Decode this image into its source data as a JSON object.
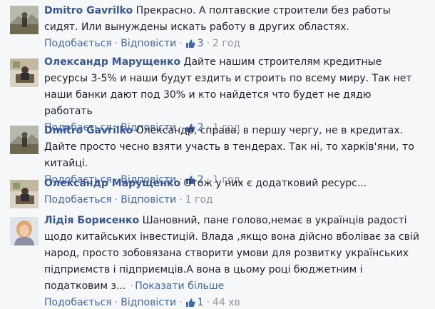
{
  "colors": {
    "author": "#365899",
    "link": "#4267b2",
    "meta": "#90949c",
    "text": "#1d2129",
    "background": "#f6f7f9"
  },
  "comments": [
    {
      "author": "Dmitro Gavrilko",
      "text": "Прекрасно. А полтавские строители без работы сидят. Или вынуждены искать работу в других областях.",
      "like_label": "Подобається",
      "reply_label": "Відповісти",
      "like_count": "3",
      "time": "2 год",
      "avatar_icon": "outdoor-photo-avatar"
    },
    {
      "author": "Олександр Марущенко",
      "text": "Дайте нашим строителям кредитные ресурсы 3-5% и наши будут ездить и строить по всему миру. Так нет наши банки дают под 30% и кто найдется что будет не дядю работать",
      "like_label": "Подобається",
      "reply_label": "Відповісти",
      "like_count": "2",
      "time": "1 год",
      "avatar_icon": "office-photo-avatar"
    },
    {
      "author": "Dmitro Gavrilko",
      "text": "Олександр, справа, в першу чергу, не в кредитах. Дайте просто чесно взяти участь в тендерах. Так ні, то харків'яни, то китайці.",
      "like_label": "Подобається",
      "reply_label": "Відповісти",
      "like_count": "2",
      "time": "1 год",
      "avatar_icon": "outdoor-photo-avatar"
    },
    {
      "author": "Олександр Марущенко",
      "text": "Отож у них є додатковий ресурс...",
      "like_label": "Подобається",
      "reply_label": "Відповісти",
      "like_count": "",
      "time": "1 год",
      "avatar_icon": "office-photo-avatar"
    },
    {
      "author": "Лідія Борисенко",
      "text": "Шановний, пане голово,немає в українців радості щодо китайських інвестицій. Влада ,якщо вона дійсно вболіває за свій народ, просто зобовязана створити умови для розвитку українських підприємств і підприємців.А вона в цьому році бюджетним і податковим з...",
      "see_more": "Показати більше",
      "like_label": "Подобається",
      "reply_label": "Відповісти",
      "like_count": "1",
      "time": "44 хв",
      "avatar_icon": "woman-portrait-avatar"
    }
  ]
}
